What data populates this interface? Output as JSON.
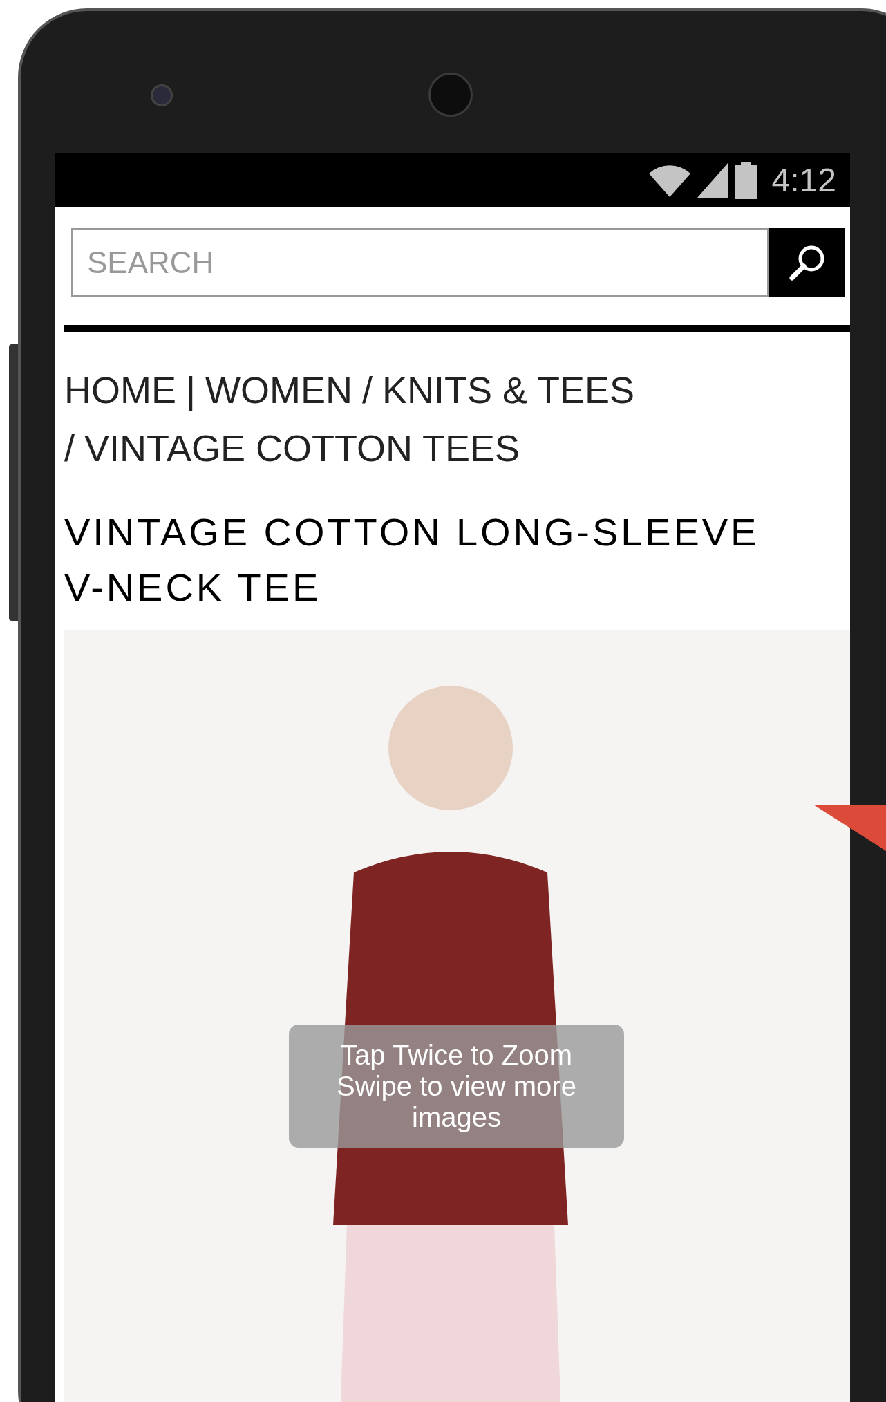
{
  "status_bar": {
    "time": "4:12"
  },
  "search": {
    "placeholder": "SEARCH"
  },
  "breadcrumb": [
    {
      "label": "HOME"
    },
    {
      "separator": "|",
      "label": "WOMEN"
    },
    {
      "separator": "/",
      "label": "KNITS & TEES"
    },
    {
      "separator": "/",
      "label": "VINTAGE COTTON TEES"
    }
  ],
  "product": {
    "title": "VINTAGE COTTON LONG-SLEEVE V-NECK TEE"
  },
  "image_hint": {
    "lines": [
      "Tap Twice to Zoom",
      "Swipe to view more images"
    ]
  }
}
